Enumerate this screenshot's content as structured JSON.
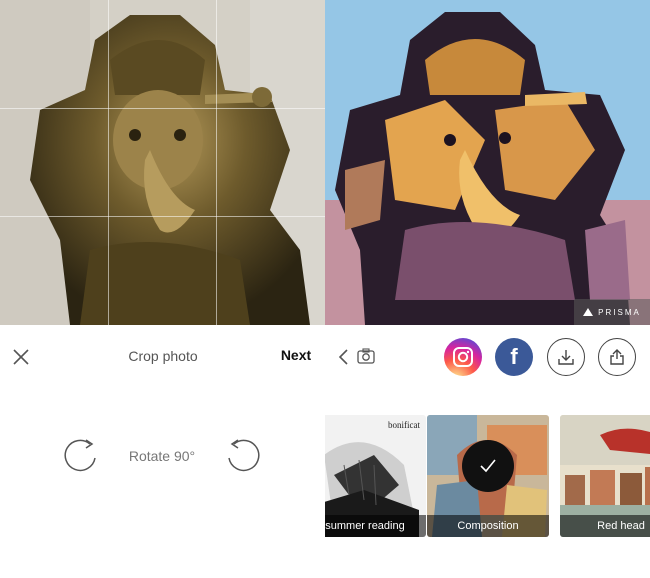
{
  "crop": {
    "title": "Crop photo",
    "next_label": "Next",
    "rotate_label": "Rotate 90°"
  },
  "result": {
    "watermark_text": "PRISMA"
  },
  "share": {
    "facebook_glyph": "f",
    "icons": [
      "instagram-icon",
      "facebook-icon",
      "download-icon",
      "share-icon"
    ]
  },
  "filters": [
    {
      "label": "summer reading",
      "overlay_text": "bonificat",
      "selected": false
    },
    {
      "label": "Composition",
      "selected": true
    },
    {
      "label": "Red head",
      "selected": false
    }
  ],
  "colors": {
    "facebook": "#3b5998",
    "check_bg": "#111111",
    "label_bg": "rgba(0,0,0,0.55)"
  }
}
